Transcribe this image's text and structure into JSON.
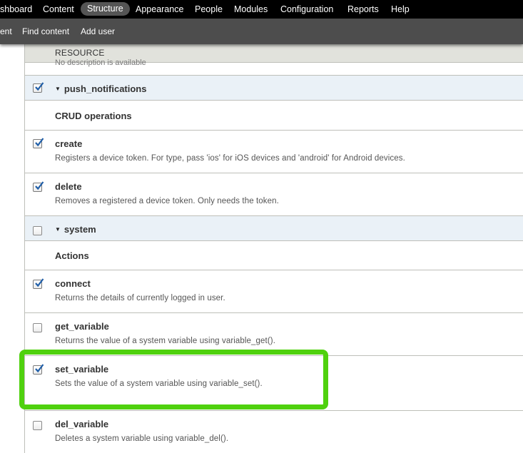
{
  "admin_menu": {
    "items": [
      "shboard",
      "Content",
      "Structure",
      "Appearance",
      "People",
      "Modules",
      "Configuration",
      "Reports",
      "Help"
    ],
    "active": "Structure"
  },
  "shortcuts": {
    "items": [
      "ent",
      "Find content",
      "Add user"
    ]
  },
  "table": {
    "header": "RESOURCE",
    "clipped_text": "No description is available",
    "groups": [
      {
        "name": "push_notifications",
        "checked": true,
        "section": "CRUD operations",
        "operations": [
          {
            "name": "create",
            "description": "Registers a device token. For type, pass 'ios' for iOS devices and 'android' for Android devices.",
            "checked": true
          },
          {
            "name": "delete",
            "description": "Removes a registered a device token. Only needs the token.",
            "checked": true
          }
        ]
      },
      {
        "name": "system",
        "checked": false,
        "section": "Actions",
        "operations": [
          {
            "name": "connect",
            "description": "Returns the details of currently logged in user.",
            "checked": true
          },
          {
            "name": "get_variable",
            "description": "Returns the value of a system variable using variable_get().",
            "checked": false
          },
          {
            "name": "set_variable",
            "description": "Sets the value of a system variable using variable_set().",
            "checked": true
          },
          {
            "name": "del_variable",
            "description": "Deletes a system variable using variable_del().",
            "checked": false
          }
        ]
      }
    ]
  },
  "colors": {
    "toolbar_bg": "#000000",
    "shortcut_bg": "#4d4d4d",
    "group_row_bg": "#eaf1f7",
    "highlight": "#4fd10e",
    "checkmark": "#1f5ea8"
  }
}
